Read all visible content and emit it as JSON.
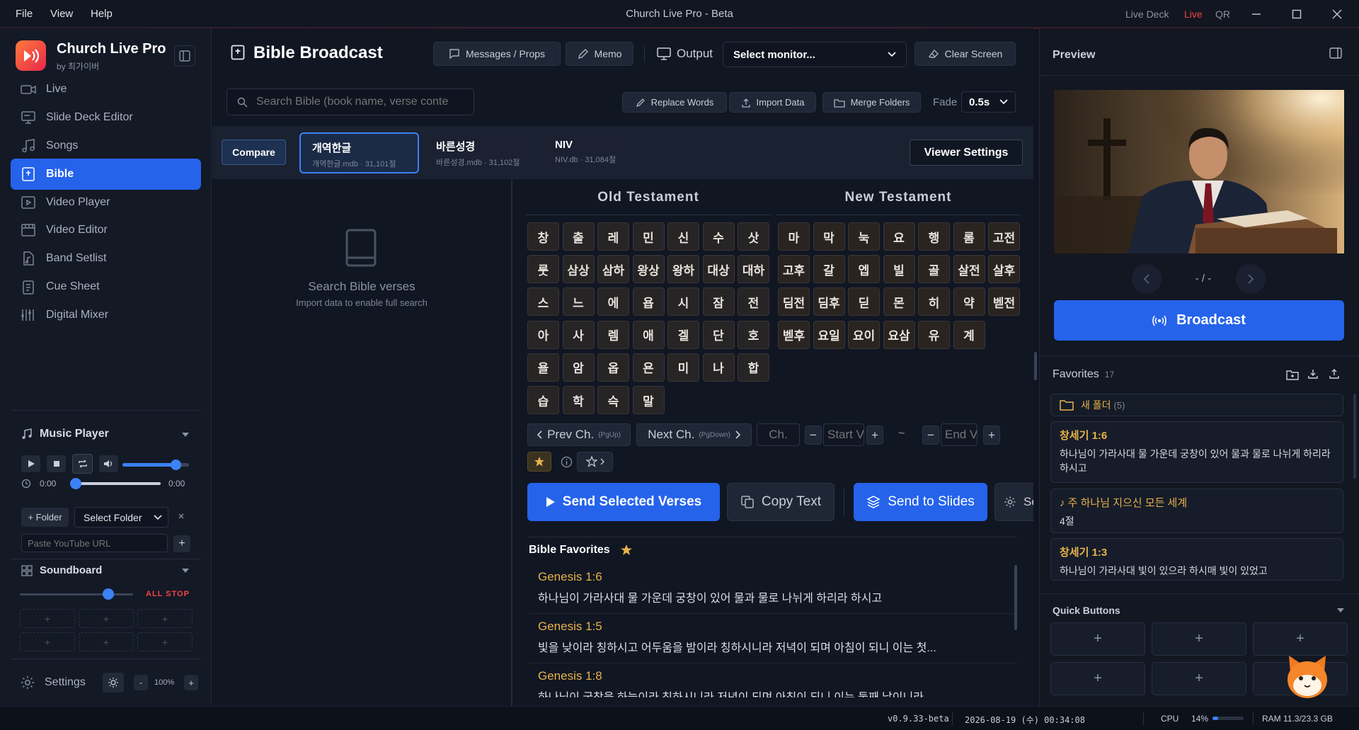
{
  "window": {
    "menu": [
      "File",
      "View",
      "Help"
    ],
    "title": "Church Live Pro - Beta",
    "live_deck": "Live Deck",
    "live": "Live",
    "qr": "QR"
  },
  "brand": {
    "name": "Church Live Pro",
    "by": "by 최가이버"
  },
  "sidebar": {
    "items": [
      {
        "label": "Live",
        "icon": "video-camera-icon"
      },
      {
        "label": "Slide Deck Editor",
        "icon": "slides-icon"
      },
      {
        "label": "Songs",
        "icon": "music-note-icon"
      },
      {
        "label": "Bible",
        "icon": "book-icon"
      },
      {
        "label": "Video Player",
        "icon": "play-icon"
      },
      {
        "label": "Video Editor",
        "icon": "film-icon"
      },
      {
        "label": "Band Setlist",
        "icon": "music-file-icon"
      },
      {
        "label": "Cue Sheet",
        "icon": "clipboard-icon"
      },
      {
        "label": "Digital Mixer",
        "icon": "mixer-icon"
      }
    ],
    "active": "Bible"
  },
  "music_player": {
    "title": "Music Player",
    "time_start": "0:00",
    "time_end": "0:00",
    "volume": 0.8,
    "progress": 0.0,
    "add_folder": "+ Folder",
    "select_folder": "Select Folder",
    "url_placeholder": "Paste YouTube URL"
  },
  "soundboard": {
    "title": "Soundboard",
    "all_stop": "ALL STOP",
    "level": 0.78
  },
  "settings": {
    "label": "Settings",
    "minus": "-",
    "zoom": "100%",
    "plus": "+"
  },
  "header": {
    "title": "Bible Broadcast",
    "messages": "Messages / Props",
    "memo": "Memo",
    "output": "Output",
    "monitor": "Select monitor...",
    "clear": "Clear Screen"
  },
  "toolbar": {
    "search_placeholder": "Search Bible (book name, verse conte",
    "replace": "Replace Words",
    "import": "Import Data",
    "merge": "Merge Folders",
    "fade_label": "Fade",
    "fade_value": "0.5s"
  },
  "translations": {
    "compare": "Compare",
    "tabs": [
      {
        "name": "개역한글",
        "meta": "개역한글.mdb · 31,101절"
      },
      {
        "name": "바른성경",
        "meta": "바른성경.mdb · 31,102절"
      },
      {
        "name": "NIV",
        "meta": "NIV.db · 31,084절"
      }
    ],
    "viewer_settings": "Viewer Settings"
  },
  "search_empty": {
    "title": "Search Bible verses",
    "hint": "Import data to enable full search"
  },
  "books": {
    "ot_title": "Old Testament",
    "nt_title": "New Testament",
    "ot": [
      "창",
      "출",
      "레",
      "민",
      "신",
      "수",
      "삿",
      "룻",
      "삼상",
      "삼하",
      "왕상",
      "왕하",
      "대상",
      "대하",
      "스",
      "느",
      "에",
      "욥",
      "시",
      "잠",
      "전",
      "아",
      "사",
      "렘",
      "애",
      "겔",
      "단",
      "호",
      "욜",
      "암",
      "옵",
      "욘",
      "미",
      "나",
      "합",
      "습",
      "학",
      "슥",
      "말"
    ],
    "nt": [
      "마",
      "막",
      "눅",
      "요",
      "행",
      "롬",
      "고전",
      "고후",
      "갈",
      "엡",
      "빌",
      "골",
      "살전",
      "살후",
      "딤전",
      "딤후",
      "딛",
      "몬",
      "히",
      "약",
      "벧전",
      "벧후",
      "요일",
      "요이",
      "요삼",
      "유",
      "계"
    ]
  },
  "nav": {
    "prev": "Prev Ch.",
    "prev_key": "(PgUp)",
    "next": "Next Ch.",
    "next_key": "(PgDown)",
    "ch_placeholder": "Ch.",
    "start_placeholder": "Start V",
    "end_placeholder": "End Ve",
    "minus": "−",
    "plus": "+",
    "tilde": "~"
  },
  "actions": {
    "send_verses": "Send Selected Verses",
    "copy": "Copy Text",
    "send_slides": "Send to Slides",
    "settings_partial": "Se"
  },
  "bible_favorites": {
    "title": "Bible Favorites",
    "items": [
      {
        "ref": "Genesis 1:6",
        "text": "하나님이 가라사대 물 가운데 궁창이 있어 물과 물로 나뉘게 하리라 하시고"
      },
      {
        "ref": "Genesis 1:5",
        "text": "빛을 낮이라 칭하시고 어두움을 밤이라 칭하시니라 저녁이 되며 아침이 되니 이는 첫..."
      },
      {
        "ref": "Genesis 1:8",
        "text": "하나님이 궁창을 하늘이라 칭하시니라 저녁이 되며 아침이 되니 이는 둘째 날이니라"
      }
    ]
  },
  "preview": {
    "title": "Preview",
    "counter": "- / -",
    "broadcast": "Broadcast"
  },
  "favorites": {
    "title": "Favorites",
    "count": "17",
    "folder": "새 폴더",
    "folder_count": "(5)",
    "items": [
      {
        "ref": "창세기 1:6",
        "text": "하나님이 가라사대 물 가운데 궁창이 있어 물과 물로 나뉘게 하리라 하시고"
      },
      {
        "ref": "♪ 주 하나님 지으신 모든 세계",
        "text": "4절"
      },
      {
        "ref": "창세기 1:3",
        "text": "하나님이 가라사대 빛이 있으라 하시매 빛이 있었고"
      }
    ]
  },
  "quick_buttons": {
    "title": "Quick Buttons",
    "plus": "+"
  },
  "status": {
    "version": "v0.9.33-beta",
    "datetime": "2026-08-19 (수) 00:34:08",
    "cpu_label": "CPU",
    "cpu_value": "14%",
    "cpu_level": 0.14,
    "ram": "RAM 11.3/23.3 GB"
  },
  "colors": {
    "accent": "#2563eb",
    "gold": "#e8b34a",
    "live": "#ef4444"
  }
}
